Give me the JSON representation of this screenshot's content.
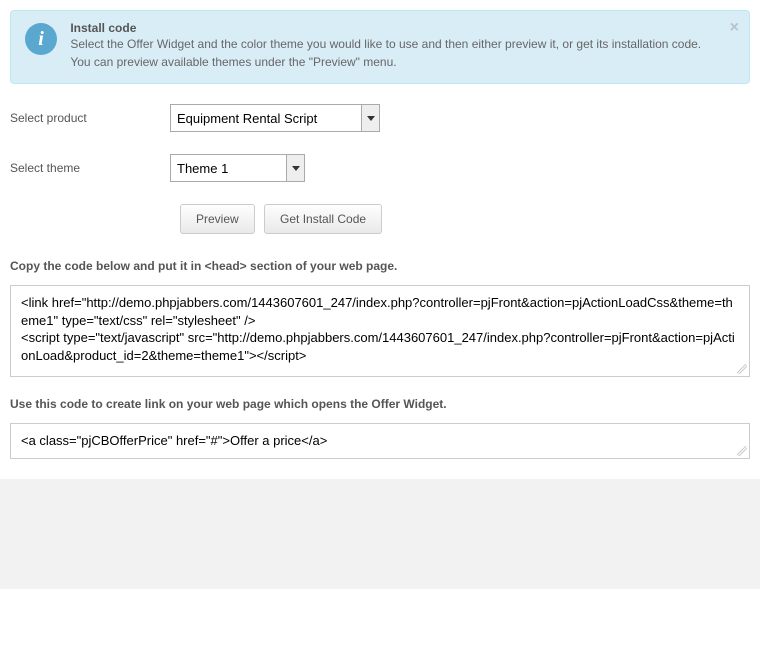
{
  "info": {
    "title": "Install code",
    "text": "Select the Offer Widget and the color theme you would like to use and then either preview it, or get its installation code. You can preview available themes under the \"Preview\" menu.",
    "close": "×"
  },
  "form": {
    "product_label": "Select product",
    "product_value": "Equipment Rental Script",
    "theme_label": "Select theme",
    "theme_value": "Theme 1"
  },
  "buttons": {
    "preview": "Preview",
    "get_code": "Get Install Code"
  },
  "sections": {
    "head_label": "Copy the code below and put it in <head> section of your web page.",
    "head_code": "<link href=\"http://demo.phpjabbers.com/1443607601_247/index.php?controller=pjFront&action=pjActionLoadCss&theme=theme1\" type=\"text/css\" rel=\"stylesheet\" />\n<script type=\"text/javascript\" src=\"http://demo.phpjabbers.com/1443607601_247/index.php?controller=pjFront&action=pjActionLoad&product_id=2&theme=theme1\"></script>",
    "link_label": "Use this code to create link on your web page which opens the Offer Widget.",
    "link_code": "<a class=\"pjCBOfferPrice\" href=\"#\">Offer a price</a>"
  }
}
